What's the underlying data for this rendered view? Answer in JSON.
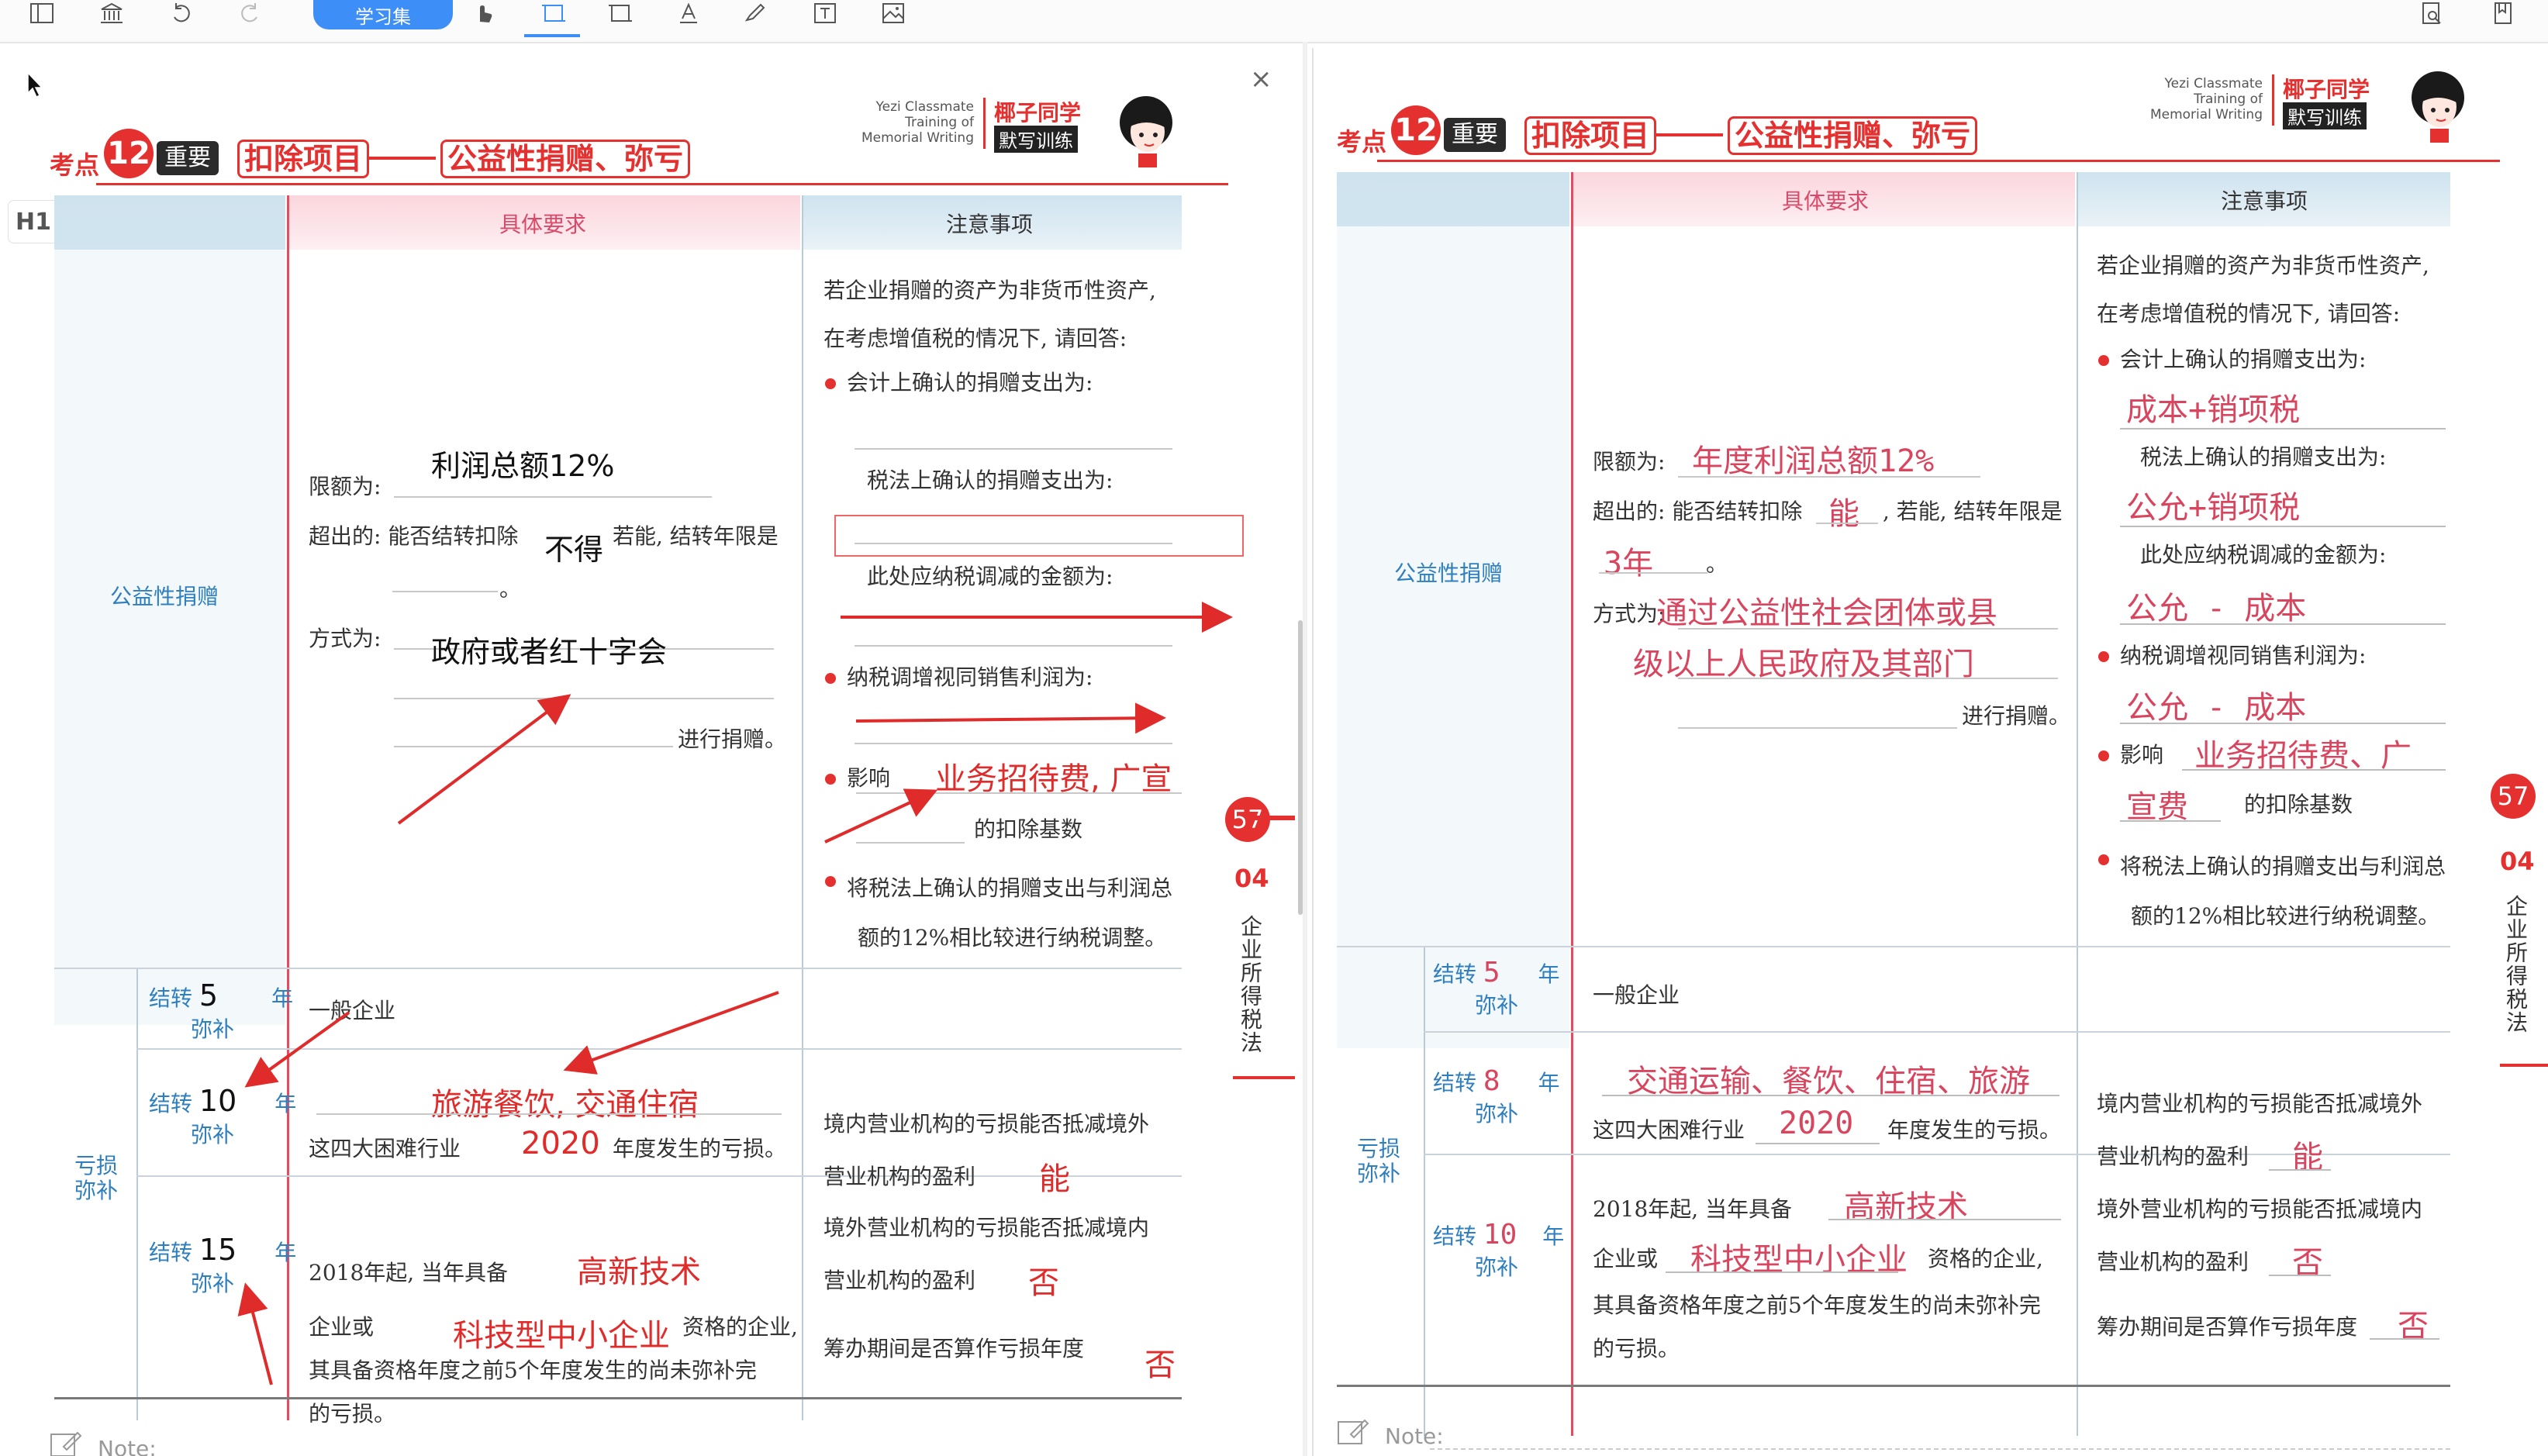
{
  "toolbar": {
    "pill_label": "学习集",
    "icons": [
      "sidebar-icon",
      "library-icon",
      "undo-icon",
      "redo-icon",
      "hand-icon",
      "crop-select-icon",
      "rect-select-icon",
      "text-icon",
      "pen-icon",
      "textbox-icon",
      "image-icon",
      "search-doc-icon",
      "bookmark-icon"
    ]
  },
  "left_page": {
    "h1_badge": "H1",
    "close_label": "×",
    "brand": {
      "en_line1": "Yezi Classmate",
      "en_line2": "Training of",
      "en_line3": "Memorial Writing",
      "cn_name": "椰子同学",
      "cn_sub": "默写训练"
    },
    "header": {
      "kaodian": "考点",
      "number": "12",
      "importance": "重要",
      "title_a": "扣除项目",
      "title_b": "公益性捐赠、弥亏"
    },
    "columns": {
      "c2": "具体要求",
      "c3": "注意事项"
    },
    "row1_label": "公益性捐赠",
    "row2_label_line1": "亏损",
    "row2_label_line2": "弥补",
    "req": {
      "limit_label": "限额为:",
      "limit_fill": "利润总额12%",
      "excess_label": "超出的: 能否结转扣除",
      "excess_fill": "不得",
      "excess_after": "若能, 结转年限是",
      "excess_end": "。",
      "method_label": "方式为:",
      "method_fill": "政府或者红十字会",
      "method_end": "进行捐赠。"
    },
    "notes": {
      "intro1": "若企业捐赠的资产为非货币性资产,",
      "intro2": "在考虑增值税的情况下, 请回答:",
      "b1": "会计上确认的捐赠支出为:",
      "b1_sub1": "税法上确认的捐赠支出为:",
      "b1_sub2": "此处应纳税调减的金额为:",
      "b2": "纳税调增视同销售利润为:",
      "b3_label": "影响",
      "b3_fill": "业务招待费, 广宣",
      "b3_after": "的扣除基数",
      "b4_line1": "将税法上确认的捐赠支出与利润总",
      "b4_line2": "额的12%相比较进行纳税调整。"
    },
    "loss_rows": [
      {
        "prefix": "结转",
        "years": "5",
        "suffix": "年",
        "sub": "弥补",
        "req": "一般企业"
      },
      {
        "prefix": "结转",
        "years": "10",
        "suffix": "年",
        "sub": "弥补",
        "req_fill": "旅游餐饮, 交通住宿",
        "req_line2a": "这四大困难行业",
        "req_line2_fill": "2020",
        "req_line2b": "年度发生的亏损。"
      },
      {
        "prefix": "结转",
        "years": "15",
        "suffix": "年",
        "sub": "弥补",
        "req_line1a": "2018年起, 当年具备",
        "req_line1_fill": "高新技术",
        "req_line2a": "企业或",
        "req_line2_fill": "科技型中小企业",
        "req_line2b": "资格的企业,",
        "req_line3": "其具备资格年度之前5个年度发生的尚未弥补完",
        "req_line4": "的亏损。"
      }
    ],
    "loss_notes": {
      "l1": "境内营业机构的亏损能否抵减境外",
      "l2": "营业机构的盈利",
      "l2_fill": "能",
      "l3": "境外营业机构的亏损能否抵减境内",
      "l4": "营业机构的盈利",
      "l4_fill": "否",
      "l5": "筹办期间是否算作亏损年度",
      "l5_fill": "否"
    },
    "side_tab": {
      "page": "57",
      "chapter": "04",
      "chapter_title": "企业所得税法"
    },
    "note_label": "Note:"
  },
  "right_page": {
    "brand": {
      "en_line1": "Yezi Classmate",
      "en_line2": "Training of",
      "en_line3": "Memorial Writing",
      "cn_name": "椰子同学",
      "cn_sub": "默写训练"
    },
    "header": {
      "kaodian": "考点",
      "number": "12",
      "importance": "重要",
      "title_a": "扣除项目",
      "title_b": "公益性捐赠、弥亏"
    },
    "columns": {
      "c2": "具体要求",
      "c3": "注意事项"
    },
    "row1_label": "公益性捐赠",
    "row2_label_line1": "亏损",
    "row2_label_line2": "弥补",
    "req": {
      "limit_label": "限额为:",
      "limit_fill": "年度利润总额12%",
      "excess_label": "超出的: 能否结转扣除",
      "excess_fill": "能",
      "excess_after": ", 若能, 结转年限是",
      "excess_year": "3年",
      "excess_end": "。",
      "method_label": "方式为:",
      "method_fill1": "通过公益性社会团体或县",
      "method_fill2": "级以上人民政府及其部门",
      "method_end": "进行捐赠。"
    },
    "notes": {
      "intro1": "若企业捐赠的资产为非货币性资产,",
      "intro2": "在考虑增值税的情况下, 请回答:",
      "b1": "会计上确认的捐赠支出为:",
      "b1_fill": "成本+销项税",
      "b1_sub1": "税法上确认的捐赠支出为:",
      "b1_sub1_fill": "公允+销项税",
      "b1_sub2": "此处应纳税调减的金额为:",
      "b1_sub2_fill": "公允 - 成本",
      "b2": "纳税调增视同销售利润为:",
      "b2_fill": "公允 - 成本",
      "b3_label": "影响",
      "b3_fill1": "业务招待费、广",
      "b3_fill2": "宣费",
      "b3_after": "的扣除基数",
      "b4_line1": "将税法上确认的捐赠支出与利润总",
      "b4_line2": "额的12%相比较进行纳税调整。"
    },
    "loss_rows": [
      {
        "prefix": "结转",
        "years": "5",
        "suffix": "年",
        "sub": "弥补",
        "req": "一般企业"
      },
      {
        "prefix": "结转",
        "years": "8",
        "suffix": "年",
        "sub": "弥补",
        "req_fill": "交通运输、餐饮、住宿、旅游",
        "req_line2a": "这四大困难行业",
        "req_line2_fill": "2020",
        "req_line2b": "年度发生的亏损。"
      },
      {
        "prefix": "结转",
        "years": "10",
        "suffix": "年",
        "sub": "弥补",
        "req_line1a": "2018年起, 当年具备",
        "req_line1_fill": "高新技术",
        "req_line2a": "企业或",
        "req_line2_fill": "科技型中小企业",
        "req_line2b": "资格的企业,",
        "req_line3": "其具备资格年度之前5个年度发生的尚未弥补完",
        "req_line4": "的亏损。"
      }
    ],
    "loss_notes": {
      "l1": "境内营业机构的亏损能否抵减境外",
      "l2": "营业机构的盈利",
      "l2_fill": "能",
      "l3": "境外营业机构的亏损能否抵减境内",
      "l4": "营业机构的盈利",
      "l4_fill": "否",
      "l5": "筹办期间是否算作亏损年度",
      "l5_fill": "否"
    },
    "side_tab": {
      "page": "57",
      "chapter": "04",
      "chapter_title": "企业所得税法"
    },
    "note_label": "Note:"
  },
  "colors": {
    "accent_blue": "#3d8ef6",
    "brand_red": "#e4302f",
    "handwriting_red": "#e02b2b",
    "handwriting_pink": "#d8455f",
    "band_blue": "#cfe3ef",
    "band_pink": "#fbd6dd"
  }
}
